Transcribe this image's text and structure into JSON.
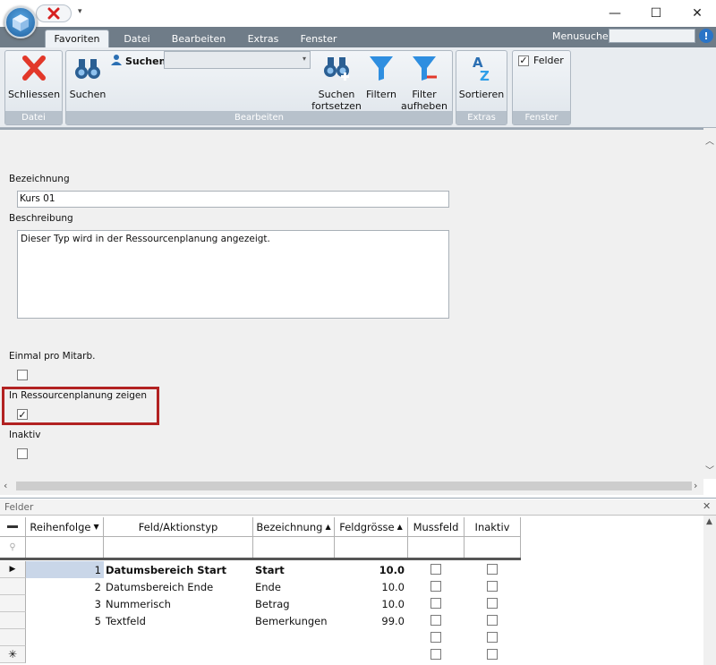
{
  "ribbon": {
    "tabs": [
      "Favoriten",
      "Datei",
      "Bearbeiten",
      "Extras",
      "Fenster"
    ],
    "menusearch_label": "Menusuche",
    "help_label": "!",
    "buttons": {
      "schliessen": "Schliessen",
      "suchen": "Suchen",
      "suchen_small": "Suchen",
      "suchen_fortsetzen": "Suchen\nfortsetzen",
      "filtern": "Filtern",
      "filter_aufheben": "Filter\naufheben",
      "sortieren": "Sortieren",
      "felder": "Felder"
    },
    "groups": {
      "datei": "Datei",
      "bearbeiten": "Bearbeiten",
      "extras": "Extras",
      "fenster": "Fenster"
    }
  },
  "form": {
    "bezeichnung_label": "Bezeichnung",
    "bezeichnung_value": "Kurs 01",
    "beschreibung_label": "Beschreibung",
    "beschreibung_value": "Dieser Typ wird in der Ressourcenplanung angezeigt.",
    "einmal_label": "Einmal pro Mitarb.",
    "einmal_checked": false,
    "ressourcen_label": "In Ressourcenplanung zeigen",
    "ressourcen_checked": true,
    "inaktiv_label": "Inaktiv",
    "inaktiv_checked": false
  },
  "felder": {
    "panel_title": "Felder",
    "columns": [
      "Reihenfolge",
      "Feld/Aktionstyp",
      "Bezeichnung",
      "Feldgrösse",
      "Mussfeld",
      "Inaktiv"
    ],
    "rows": [
      {
        "order": "1",
        "field": "Datumsbereich Start",
        "label": "Start",
        "size": "10.0"
      },
      {
        "order": "2",
        "field": "Datumsbereich Ende",
        "label": "Ende",
        "size": "10.0"
      },
      {
        "order": "3",
        "field": "Nummerisch",
        "label": "Betrag",
        "size": "10.0"
      },
      {
        "order": "5",
        "field": "Textfeld",
        "label": "Bemerkungen",
        "size": "99.0"
      }
    ]
  },
  "colors": {
    "accent": "#b22222",
    "tab_strip": "#6f7c88",
    "selection": "#c9d6e8"
  },
  "icons": [
    "app-logo-icon",
    "close-red-icon",
    "binoculars-icon",
    "user-search-icon",
    "binoculars-plus-icon",
    "funnel-icon",
    "funnel-clear-icon",
    "sort-az-icon",
    "minimize-icon",
    "maximize-icon",
    "close-window-icon"
  ]
}
